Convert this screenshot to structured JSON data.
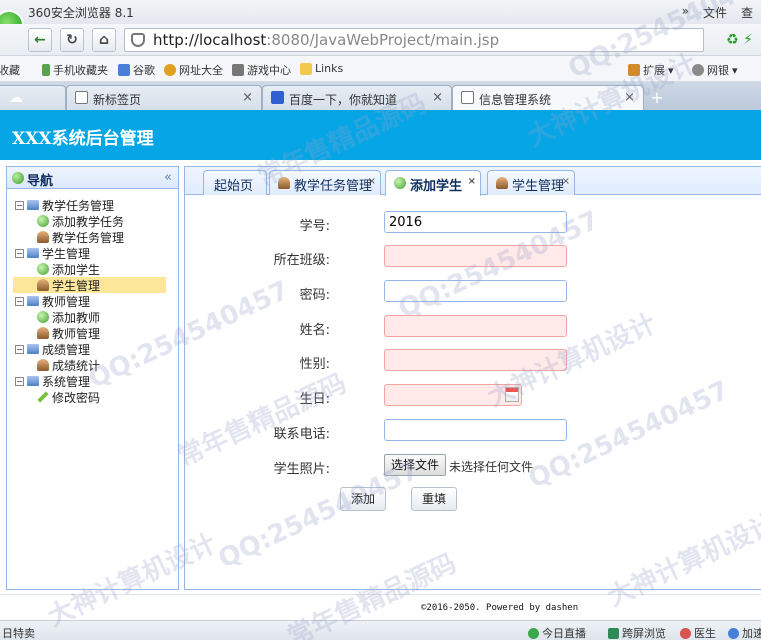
{
  "browser": {
    "title": "360安全浏览器 8.1",
    "title_right": [
      "»",
      "文件",
      "查"
    ],
    "url_host": "http://localhost",
    "url_rest": ":8080/JavaWebProject/main.jsp",
    "bookmarks": [
      {
        "label": "收藏",
        "color": "#d9b640"
      },
      {
        "label": "手机收藏夹",
        "color": "#5aa34a"
      },
      {
        "label": "谷歌",
        "color": "#4a7fd9"
      },
      {
        "label": "网址大全",
        "color": "#e0a020"
      },
      {
        "label": "游戏中心",
        "color": "#777"
      },
      {
        "label": "Links",
        "color": "#f2c94c"
      },
      {
        "label": "扩展",
        "color": "#d28a2a"
      },
      {
        "label": "网银",
        "color": "#8a8a8a"
      }
    ],
    "tabs": [
      {
        "label": "新标签页"
      },
      {
        "label": "百度一下，你就知道"
      },
      {
        "label": "信息管理系统"
      }
    ],
    "tab_close": "×",
    "new_tab": "+"
  },
  "header": {
    "app_title": "XXX系统后台管理"
  },
  "sidebar": {
    "title": "导航",
    "collapse": "«",
    "groups": [
      {
        "label": "教学任务管理",
        "children": [
          {
            "label": "添加教学任务",
            "icon": "add"
          },
          {
            "label": "教学任务管理",
            "icon": "user"
          }
        ]
      },
      {
        "label": "学生管理",
        "children": [
          {
            "label": "添加学生",
            "icon": "add"
          },
          {
            "label": "学生管理",
            "icon": "user",
            "selected": true
          }
        ]
      },
      {
        "label": "教师管理",
        "children": [
          {
            "label": "添加教师",
            "icon": "add"
          },
          {
            "label": "教师管理",
            "icon": "user"
          }
        ]
      },
      {
        "label": "成绩管理",
        "children": [
          {
            "label": "成绩统计",
            "icon": "user"
          }
        ]
      },
      {
        "label": "系统管理",
        "children": [
          {
            "label": "修改密码",
            "icon": "pencil"
          }
        ]
      }
    ]
  },
  "tabs": [
    {
      "label": "起始页",
      "closable": false
    },
    {
      "label": "教学任务管理",
      "closable": true
    },
    {
      "label": "添加学生",
      "closable": true,
      "active": true
    },
    {
      "label": "学生管理",
      "closable": true
    }
  ],
  "tab_close": "×",
  "form": {
    "fields": [
      {
        "label": "学号:",
        "value": "2016",
        "invalid": false
      },
      {
        "label": "所在班级:",
        "value": "",
        "invalid": true
      },
      {
        "label": "密码:",
        "value": "",
        "invalid": false
      },
      {
        "label": "姓名:",
        "value": "",
        "invalid": true
      },
      {
        "label": "性别:",
        "value": "",
        "invalid": true
      },
      {
        "label": "生日:",
        "value": "",
        "invalid": true,
        "type": "date"
      },
      {
        "label": "联系电话:",
        "value": "",
        "invalid": false
      }
    ],
    "photo_label": "学生照片:",
    "file_button": "选择文件",
    "file_status": "未选择任何文件",
    "submit_label": "添加",
    "reset_label": "重填"
  },
  "footer": {
    "copyright": "©2016-2050. Powered by dashen"
  },
  "statusbar": {
    "left": "日特卖",
    "items": [
      {
        "label": "今日直播",
        "color": "#3aa84a"
      },
      {
        "label": "跨屏浏览",
        "color": "#2e8b57"
      },
      {
        "label": "医生",
        "color": "#d9534f"
      },
      {
        "label": "加速",
        "color": "#4a7fd9"
      }
    ]
  },
  "watermarks": [
    "QQ:254540457",
    "大神计算机设计",
    "常年售精品源码"
  ]
}
